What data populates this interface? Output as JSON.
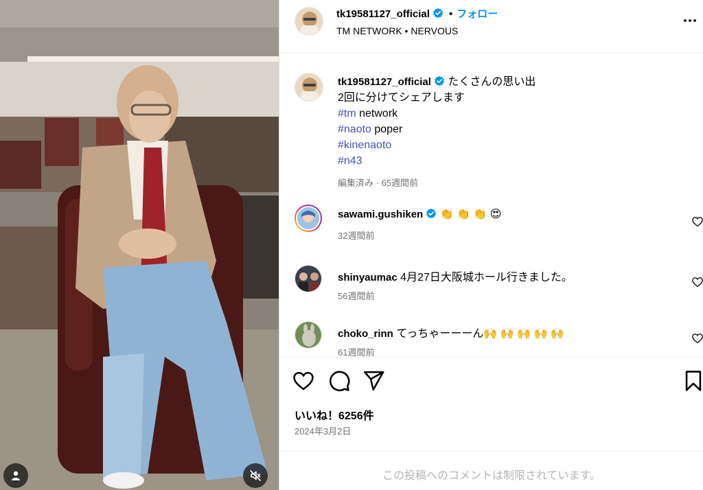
{
  "post": {
    "username": "tk19581127_official",
    "follow_label": "フォロー",
    "separator": "•",
    "location_text": "TM NETWORK • NERVOUS",
    "caption_lines": [
      "たくさんの思い出",
      "2回に分けてシェアします"
    ],
    "hashtag_lines": [
      {
        "tag": "#tm",
        "rest": " network"
      },
      {
        "tag": "#naoto",
        "rest": " poper"
      },
      {
        "tag": "#kinenaoto",
        "rest": ""
      },
      {
        "tag": "#n43",
        "rest": ""
      }
    ],
    "caption_meta": "編集済み · 65週間前",
    "likes": "いいね！6256件",
    "date": "2024年3月2日",
    "restricted_notice": "この投稿へのコメントは制限されています。"
  },
  "comments": [
    {
      "username": "sawami.gushiken",
      "verified": true,
      "text": "👏 👏 👏 😍",
      "time": "32週間前"
    },
    {
      "username": "shinyaumac",
      "verified": false,
      "text": "4月27日大阪城ホール行きました。",
      "time": "56週間前"
    },
    {
      "username": "choko_rinn",
      "verified": false,
      "text": "てっちゃーーーん🙌 🙌 🙌 🙌 🙌",
      "time": "61週間前"
    }
  ],
  "icons": {
    "verified": "verified-badge-icon",
    "more": "more-options-icon",
    "like": "heart-icon",
    "comment": "comment-bubble-icon",
    "share": "paper-plane-icon",
    "save": "bookmark-icon",
    "tag": "user-tag-icon",
    "mute": "speaker-muted-icon"
  },
  "colors": {
    "accent": "#0095f6",
    "hashtag": "#4552b8",
    "secondary_text": "#737373",
    "verified": "#0095f6"
  }
}
